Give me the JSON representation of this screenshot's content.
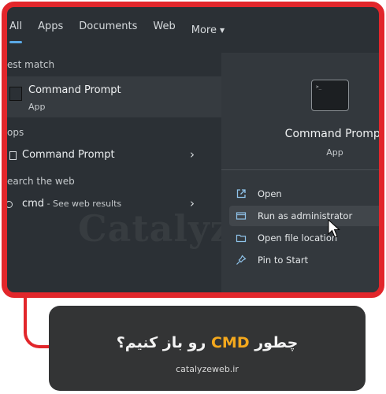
{
  "tabs": [
    {
      "label": "All",
      "active": true
    },
    {
      "label": "Apps"
    },
    {
      "label": "Documents"
    },
    {
      "label": "Web"
    },
    {
      "label": "More"
    }
  ],
  "left": {
    "best_match_label": "est match",
    "best": {
      "title": "Command Prompt",
      "subtitle": "App",
      "icon": "terminal-icon"
    },
    "apps_label": "ops",
    "apps_item": {
      "label": "Command Prompt",
      "icon": "app-icon"
    },
    "web_label": "earch the web",
    "web_item": {
      "query": "cmd",
      "suffix": " - See web results",
      "icon": "search-icon"
    }
  },
  "right": {
    "app_title": "Command Prompt",
    "app_subtitle": "App",
    "actions": [
      {
        "label": "Open",
        "icon": "open-icon"
      },
      {
        "label": "Run as administrator",
        "icon": "shield-icon"
      },
      {
        "label": "Open file location",
        "icon": "folder-icon"
      },
      {
        "label": "Pin to Start",
        "icon": "pin-icon"
      }
    ]
  },
  "watermark": "Catalyz",
  "banner": {
    "title_part1": "چطور",
    "title_highlight": " CMD ",
    "title_part2": "رو باز کنیم؟",
    "url": "catalyzeweb.ir"
  },
  "colors": {
    "frame_border": "#e2262b",
    "accent": "#5aa9e6",
    "banner_highlight": "#f4a81d"
  }
}
